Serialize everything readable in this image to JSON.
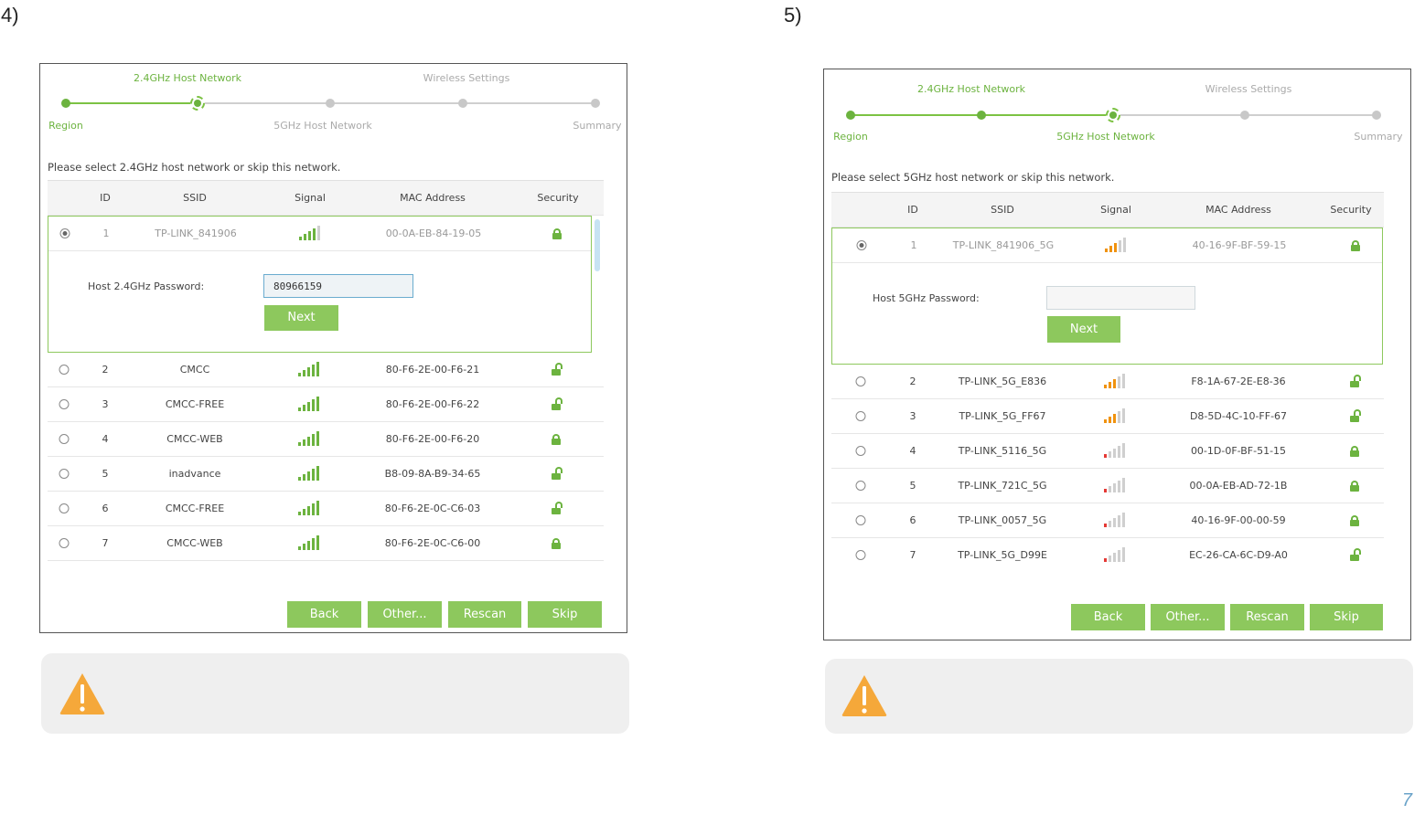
{
  "left": {
    "step_label": "4)",
    "wizard": {
      "top_labels": [
        "2.4GHz Host Network",
        "Wireless Settings"
      ],
      "bottom_labels": [
        "Region",
        "5GHz Host Network",
        "Summary"
      ],
      "active_step": "2.4GHz Host Network"
    },
    "instruction": "Please select 2.4GHz host network or skip this network.",
    "columns": [
      "ID",
      "SSID",
      "Signal",
      "MAC Address",
      "Security"
    ],
    "selected_row": {
      "id": "1",
      "ssid": "TP-LINK_841906",
      "mac": "00-0A-EB-84-19-05",
      "signal_bars": 4,
      "secured": true
    },
    "password_label": "Host 2.4GHz Password:",
    "password_value": "80966159",
    "next_label": "Next",
    "rows": [
      {
        "id": "2",
        "ssid": "CMCC",
        "mac": "80-F6-2E-00-F6-21",
        "signal_bars": 5,
        "secured": false
      },
      {
        "id": "3",
        "ssid": "CMCC-FREE",
        "mac": "80-F6-2E-00-F6-22",
        "signal_bars": 5,
        "secured": false
      },
      {
        "id": "4",
        "ssid": "CMCC-WEB",
        "mac": "80-F6-2E-00-F6-20",
        "signal_bars": 5,
        "secured": true
      },
      {
        "id": "5",
        "ssid": "inadvance",
        "mac": "B8-09-8A-B9-34-65",
        "signal_bars": 5,
        "secured": false
      },
      {
        "id": "6",
        "ssid": "CMCC-FREE",
        "mac": "80-F6-2E-0C-C6-03",
        "signal_bars": 5,
        "secured": false
      },
      {
        "id": "7",
        "ssid": "CMCC-WEB",
        "mac": "80-F6-2E-0C-C6-00",
        "signal_bars": 5,
        "secured": true
      }
    ],
    "buttons": [
      "Back",
      "Other...",
      "Rescan",
      "Skip"
    ]
  },
  "right": {
    "step_label": "5)",
    "wizard": {
      "top_labels": [
        "2.4GHz Host Network",
        "Wireless Settings"
      ],
      "bottom_labels": [
        "Region",
        "5GHz Host Network",
        "Summary"
      ],
      "active_step": "5GHz Host Network"
    },
    "instruction": "Please select 5GHz host network or skip this network.",
    "columns": [
      "ID",
      "SSID",
      "Signal",
      "MAC Address",
      "Security"
    ],
    "selected_row": {
      "id": "1",
      "ssid": "TP-LINK_841906_5G",
      "mac": "40-16-9F-BF-59-15",
      "signal_bars": 3,
      "secured": true
    },
    "password_label": "Host 5GHz Password:",
    "password_value": "",
    "next_label": "Next",
    "rows": [
      {
        "id": "2",
        "ssid": "TP-LINK_5G_E836",
        "mac": "F8-1A-67-2E-E8-36",
        "signal_bars": 3,
        "secured": false
      },
      {
        "id": "3",
        "ssid": "TP-LINK_5G_FF67",
        "mac": "D8-5D-4C-10-FF-67",
        "signal_bars": 3,
        "secured": false
      },
      {
        "id": "4",
        "ssid": "TP-LINK_5116_5G",
        "mac": "00-1D-0F-BF-51-15",
        "signal_bars": 1,
        "secured": true
      },
      {
        "id": "5",
        "ssid": "TP-LINK_721C_5G",
        "mac": "00-0A-EB-AD-72-1B",
        "signal_bars": 1,
        "secured": true
      },
      {
        "id": "6",
        "ssid": "TP-LINK_0057_5G",
        "mac": "40-16-9F-00-00-59",
        "signal_bars": 1,
        "secured": true
      },
      {
        "id": "7",
        "ssid": "TP-LINK_5G_D99E",
        "mac": "EC-26-CA-6C-D9-A0",
        "signal_bars": 1,
        "secured": false
      }
    ],
    "buttons": [
      "Back",
      "Other...",
      "Rescan",
      "Skip"
    ]
  },
  "page_number": "7",
  "colors": {
    "accent": "#8dc85d",
    "signal_strong": "#6cb33f",
    "signal_medium": "#f0920e",
    "signal_weak": "#e53935",
    "warning": "#f5a83a"
  },
  "icons": [
    "radio-icon",
    "signal-icon",
    "lock-icon",
    "unlock-icon",
    "warning-icon"
  ]
}
